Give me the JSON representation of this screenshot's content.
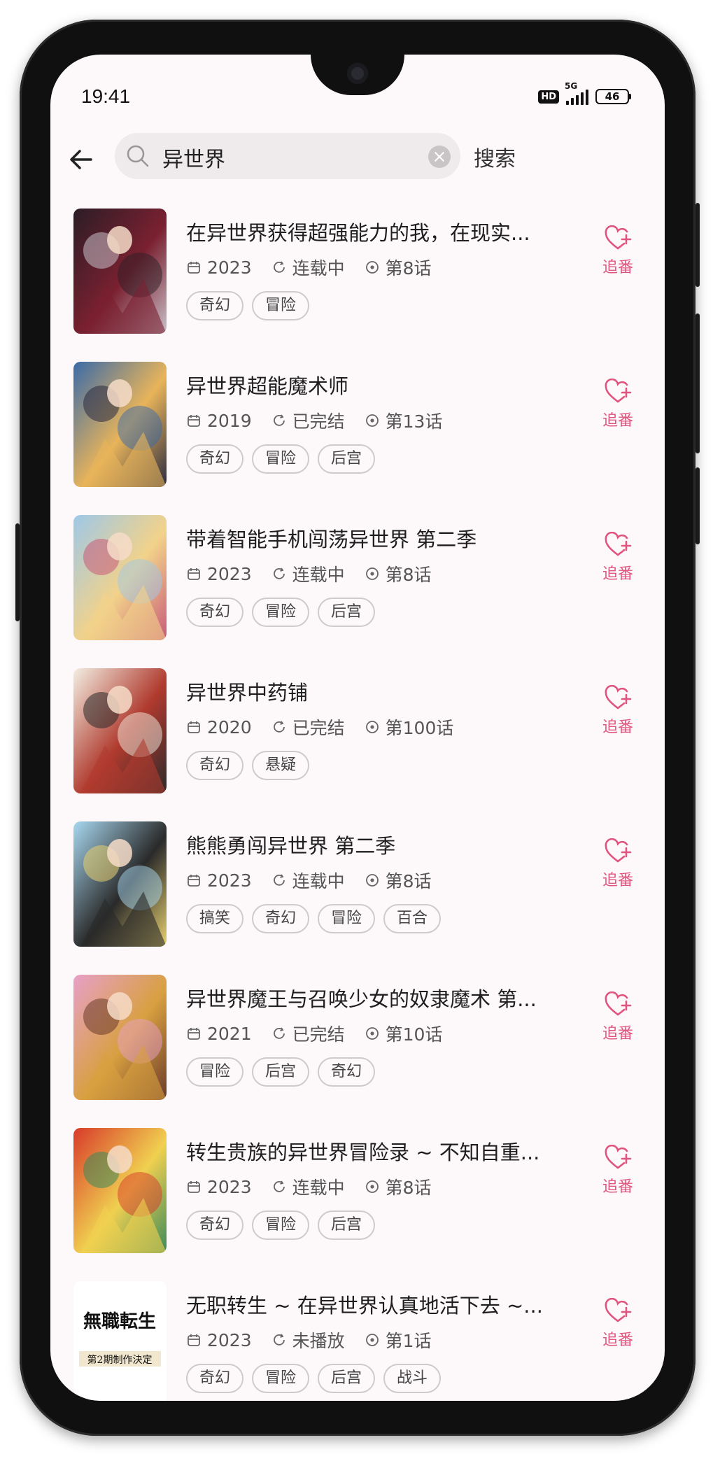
{
  "status_bar": {
    "time": "19:41",
    "hd": "HD",
    "network": "5G",
    "battery": "46"
  },
  "search": {
    "query": "异世界",
    "button": "搜索"
  },
  "accent": "#e0557f",
  "results": [
    {
      "title": "在异世界获得超强能力的我，在现实...",
      "year": "2023",
      "status": "连载中",
      "episode": "第8话",
      "tags": [
        "奇幻",
        "冒险"
      ],
      "follow": "追番",
      "poster_colors": [
        "#2b1d26",
        "#7a2030",
        "#c8c0c8"
      ]
    },
    {
      "title": "异世界超能魔术师",
      "year": "2019",
      "status": "已完结",
      "episode": "第13话",
      "tags": [
        "奇幻",
        "冒险",
        "后宫"
      ],
      "follow": "追番",
      "poster_colors": [
        "#3a6aa8",
        "#e8b45a",
        "#2a2a40"
      ]
    },
    {
      "title": "带着智能手机闯荡异世界 第二季",
      "year": "2023",
      "status": "连载中",
      "episode": "第8话",
      "tags": [
        "奇幻",
        "冒险",
        "后宫"
      ],
      "follow": "追番",
      "poster_colors": [
        "#9ec8e8",
        "#f2d28a",
        "#c85a78"
      ]
    },
    {
      "title": "异世界中药铺",
      "year": "2020",
      "status": "已完结",
      "episode": "第100话",
      "tags": [
        "奇幻",
        "悬疑"
      ],
      "follow": "追番",
      "poster_colors": [
        "#f4eee2",
        "#b03a2e",
        "#2a2a2a"
      ]
    },
    {
      "title": "熊熊勇闯异世界 第二季",
      "year": "2023",
      "status": "连载中",
      "episode": "第8话",
      "tags": [
        "搞笑",
        "奇幻",
        "冒险",
        "百合"
      ],
      "follow": "追番",
      "poster_colors": [
        "#a8d8f0",
        "#2a2a2a",
        "#e8d070"
      ]
    },
    {
      "title": "异世界魔王与召唤少女的奴隶魔术 第...",
      "year": "2021",
      "status": "已完结",
      "episode": "第10话",
      "tags": [
        "冒险",
        "后宫",
        "奇幻"
      ],
      "follow": "追番",
      "poster_colors": [
        "#e8a0c8",
        "#d8a040",
        "#6a3a2a"
      ]
    },
    {
      "title": "转生贵族的异世界冒险录 ~ 不知自重...",
      "year": "2023",
      "status": "连载中",
      "episode": "第8话",
      "tags": [
        "奇幻",
        "冒险",
        "后宫"
      ],
      "follow": "追番",
      "poster_colors": [
        "#d83a2a",
        "#f0d050",
        "#3a8a5a"
      ]
    },
    {
      "title": "无职转生 ~ 在异世界认真地活下去 ~...",
      "year": "2023",
      "status": "未播放",
      "episode": "第1话",
      "tags": [
        "奇幻",
        "冒险",
        "后宫",
        "战斗"
      ],
      "follow": "追番",
      "poster_colors": [
        "#ffffff",
        "#111111",
        "#c89a3a"
      ],
      "poster_text": [
        "無職転生",
        "第2期制作決定"
      ]
    }
  ]
}
